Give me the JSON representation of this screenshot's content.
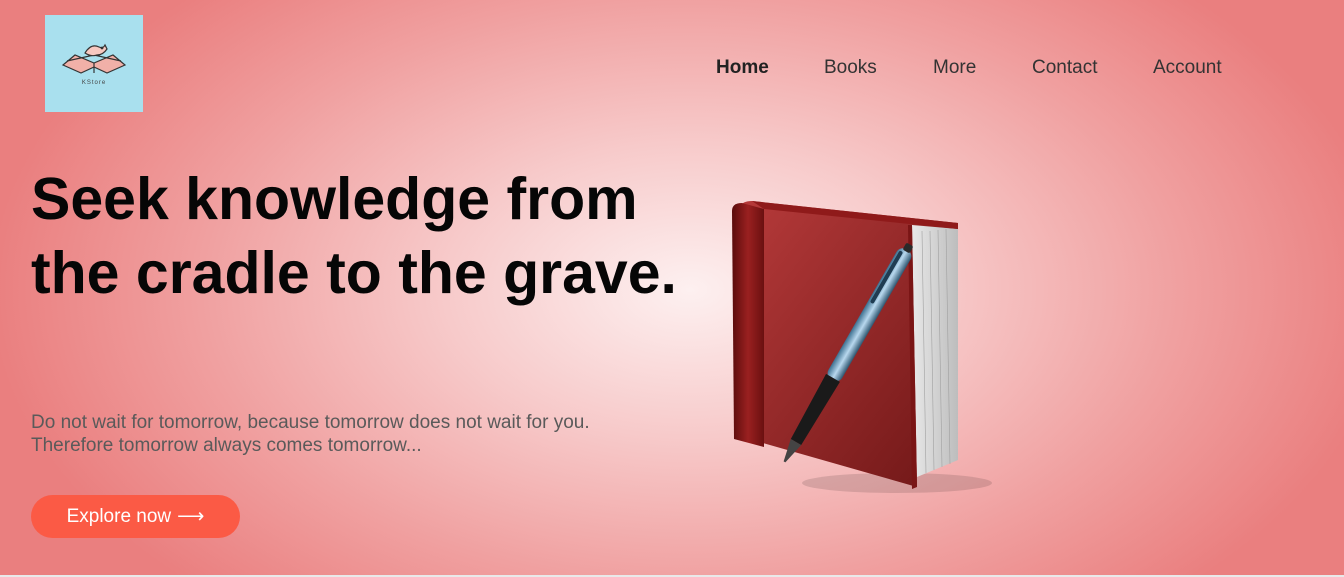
{
  "brand": {
    "logo_text": "KStore"
  },
  "nav": {
    "items": [
      {
        "label": "Home",
        "active": true
      },
      {
        "label": "Books",
        "active": false
      },
      {
        "label": "More",
        "active": false
      },
      {
        "label": "Contact",
        "active": false
      },
      {
        "label": "Account",
        "active": false
      }
    ]
  },
  "hero": {
    "title": "Seek knowledge from the cradle to the grave.",
    "subtitle_line1": "Do not wait for tomorrow, because tomorrow does not wait for you.",
    "subtitle_line2": "Therefore tomorrow always comes tomorrow...",
    "cta_label": "Explore now",
    "cta_arrow": "⟶",
    "image": "book-and-pen-illustration"
  },
  "colors": {
    "accent": "#fb5a45",
    "background": "#f0a0a0",
    "logo_bg": "#a9e0ee"
  }
}
